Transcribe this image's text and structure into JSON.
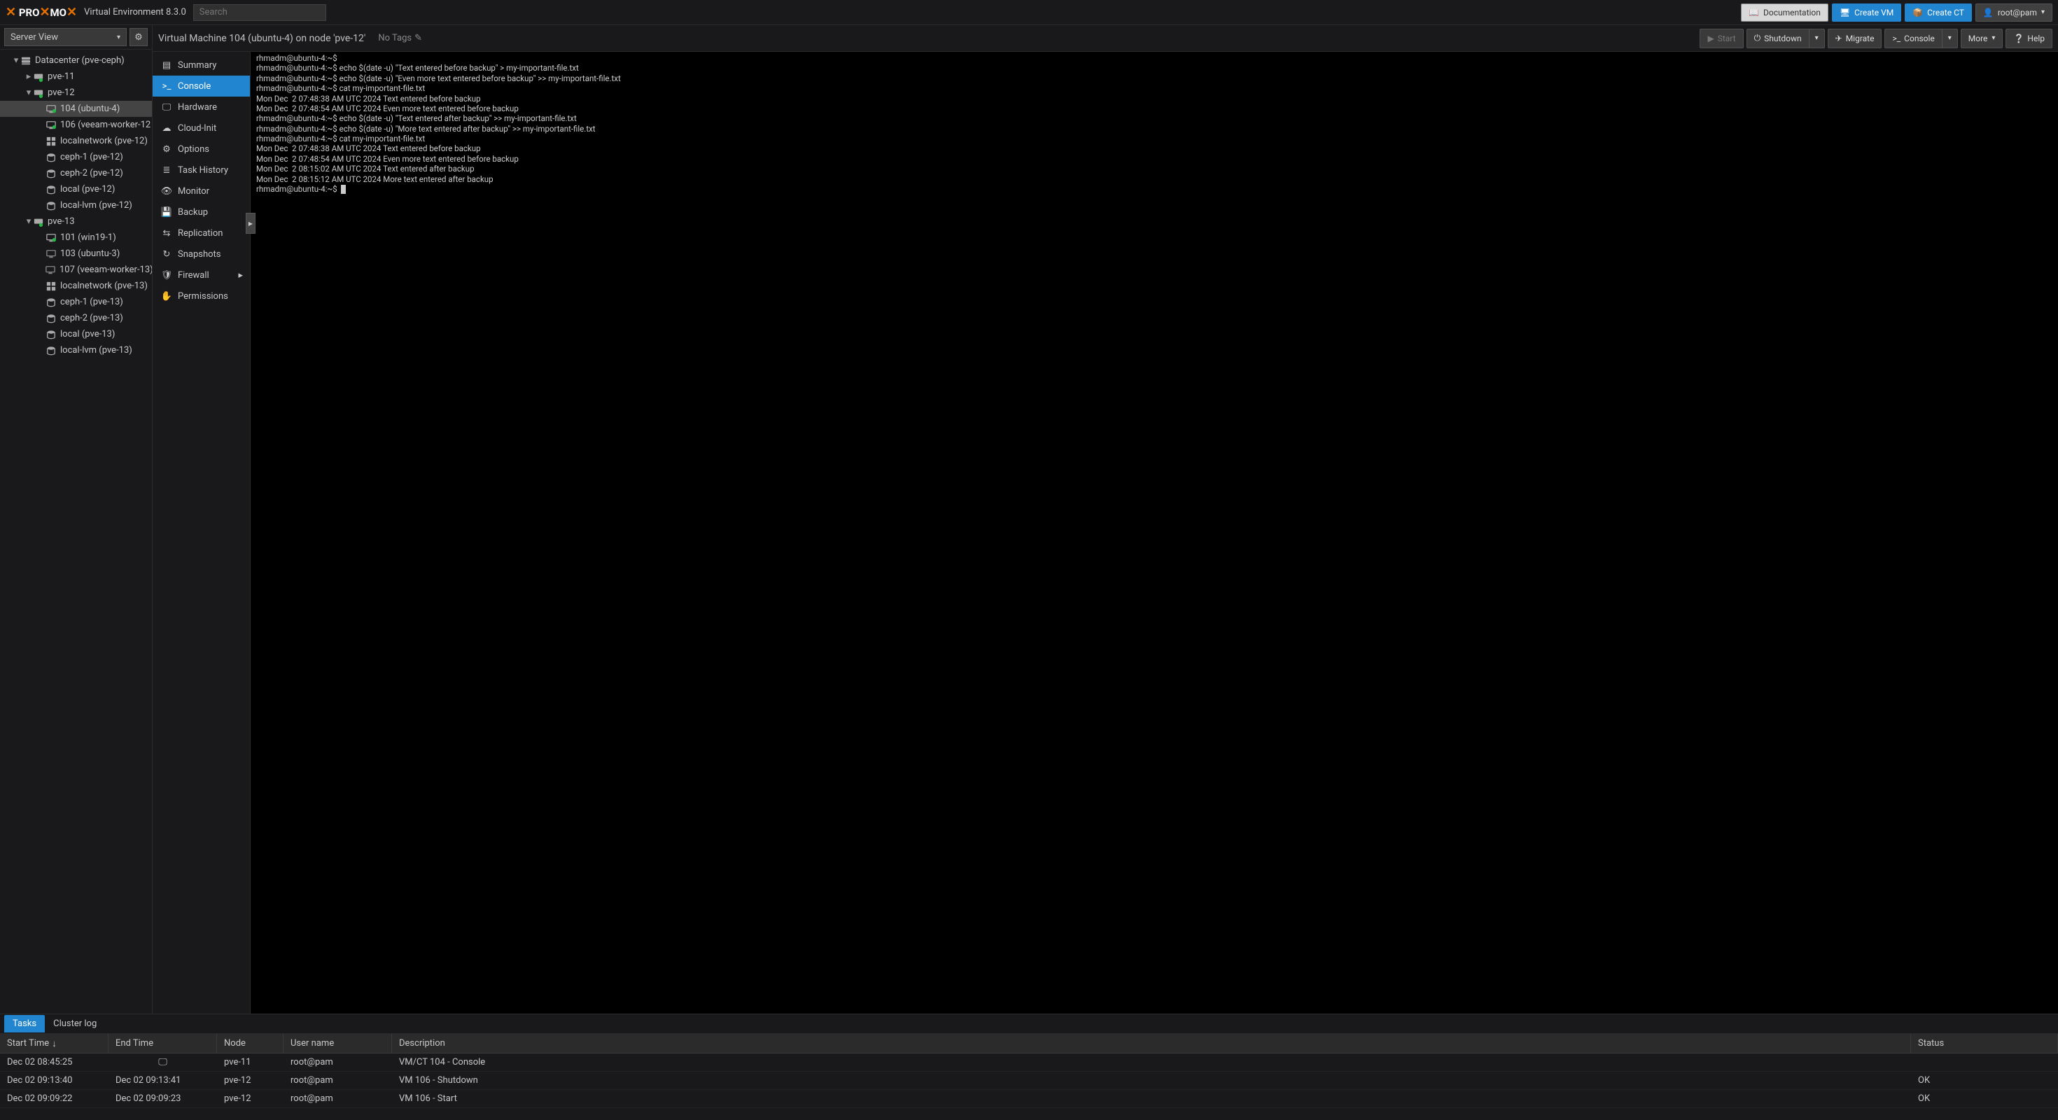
{
  "header": {
    "product": "Virtual Environment 8.3.0",
    "search_placeholder": "Search",
    "documentation": "Documentation",
    "create_vm": "Create VM",
    "create_ct": "Create CT",
    "user": "root@pam"
  },
  "view_selector": "Server View",
  "tree": [
    {
      "depth": 0,
      "caret": "▾",
      "icon": "datacenter",
      "label": "Datacenter (pve-ceph)"
    },
    {
      "depth": 1,
      "caret": "▸",
      "icon": "node",
      "label": "pve-11"
    },
    {
      "depth": 1,
      "caret": "▾",
      "icon": "node",
      "label": "pve-12"
    },
    {
      "depth": 2,
      "caret": "",
      "icon": "vm",
      "label": "104 (ubuntu-4)",
      "selected": true
    },
    {
      "depth": 2,
      "caret": "",
      "icon": "vm",
      "label": "106 (veeam-worker-12"
    },
    {
      "depth": 2,
      "caret": "",
      "icon": "net",
      "label": "localnetwork (pve-12)"
    },
    {
      "depth": 2,
      "caret": "",
      "icon": "storage",
      "label": "ceph-1 (pve-12)"
    },
    {
      "depth": 2,
      "caret": "",
      "icon": "storage",
      "label": "ceph-2 (pve-12)"
    },
    {
      "depth": 2,
      "caret": "",
      "icon": "storage",
      "label": "local (pve-12)"
    },
    {
      "depth": 2,
      "caret": "",
      "icon": "storage",
      "label": "local-lvm (pve-12)"
    },
    {
      "depth": 1,
      "caret": "▾",
      "icon": "node",
      "label": "pve-13"
    },
    {
      "depth": 2,
      "caret": "",
      "icon": "vm",
      "label": "101 (win19-1)"
    },
    {
      "depth": 2,
      "caret": "",
      "icon": "vm-off",
      "label": "103 (ubuntu-3)"
    },
    {
      "depth": 2,
      "caret": "",
      "icon": "vm-off",
      "label": "107 (veeam-worker-13)"
    },
    {
      "depth": 2,
      "caret": "",
      "icon": "net",
      "label": "localnetwork (pve-13)"
    },
    {
      "depth": 2,
      "caret": "",
      "icon": "storage",
      "label": "ceph-1 (pve-13)"
    },
    {
      "depth": 2,
      "caret": "",
      "icon": "storage",
      "label": "ceph-2 (pve-13)"
    },
    {
      "depth": 2,
      "caret": "",
      "icon": "storage",
      "label": "local (pve-13)"
    },
    {
      "depth": 2,
      "caret": "",
      "icon": "storage",
      "label": "local-lvm (pve-13)"
    }
  ],
  "content_title": "Virtual Machine 104 (ubuntu-4) on node 'pve-12'",
  "no_tags": "No Tags",
  "actions": {
    "start": "Start",
    "shutdown": "Shutdown",
    "migrate": "Migrate",
    "console": "Console",
    "more": "More",
    "help": "Help"
  },
  "menu": [
    {
      "icon": "chart",
      "label": "Summary"
    },
    {
      "icon": "term",
      "label": "Console",
      "active": true
    },
    {
      "icon": "monitor",
      "label": "Hardware"
    },
    {
      "icon": "cloud",
      "label": "Cloud-Init"
    },
    {
      "icon": "gear",
      "label": "Options"
    },
    {
      "icon": "list",
      "label": "Task History"
    },
    {
      "icon": "eye",
      "label": "Monitor"
    },
    {
      "icon": "save",
      "label": "Backup"
    },
    {
      "icon": "retweet",
      "label": "Replication"
    },
    {
      "icon": "history",
      "label": "Snapshots"
    },
    {
      "icon": "shield",
      "label": "Firewall",
      "arrow": true
    },
    {
      "icon": "hand",
      "label": "Permissions"
    }
  ],
  "console_lines": [
    "rhmadm@ubuntu-4:~$",
    "rhmadm@ubuntu-4:~$ echo $(date -u) \"Text entered before backup\" > my-important-file.txt",
    "rhmadm@ubuntu-4:~$ echo $(date -u) \"Even more text entered before backup\" >> my-important-file.txt",
    "rhmadm@ubuntu-4:~$ cat my-important-file.txt",
    "Mon Dec  2 07:48:38 AM UTC 2024 Text entered before backup",
    "Mon Dec  2 07:48:54 AM UTC 2024 Even more text entered before backup",
    "rhmadm@ubuntu-4:~$ echo $(date -u) \"Text entered after backup\" >> my-important-file.txt",
    "rhmadm@ubuntu-4:~$ echo $(date -u) \"More text entered after backup\" >> my-important-file.txt",
    "rhmadm@ubuntu-4:~$ cat my-important-file.txt",
    "Mon Dec  2 07:48:38 AM UTC 2024 Text entered before backup",
    "Mon Dec  2 07:48:54 AM UTC 2024 Even more text entered before backup",
    "Mon Dec  2 08:15:02 AM UTC 2024 Text entered after backup",
    "Mon Dec  2 08:15:12 AM UTC 2024 More text entered after backup",
    "rhmadm@ubuntu-4:~$ "
  ],
  "bottom": {
    "tabs": {
      "tasks": "Tasks",
      "cluster_log": "Cluster log"
    },
    "columns": {
      "start": "Start Time",
      "end": "End Time",
      "node": "Node",
      "user": "User name",
      "desc": "Description",
      "status": "Status"
    },
    "rows": [
      {
        "start": "Dec 02 08:45:25",
        "end_icon": true,
        "end": "",
        "node": "pve-11",
        "user": "root@pam",
        "desc": "VM/CT 104 - Console",
        "status": ""
      },
      {
        "start": "Dec 02 09:13:40",
        "end": "Dec 02 09:13:41",
        "node": "pve-12",
        "user": "root@pam",
        "desc": "VM 106 - Shutdown",
        "status": "OK"
      },
      {
        "start": "Dec 02 09:09:22",
        "end": "Dec 02 09:09:23",
        "node": "pve-12",
        "user": "root@pam",
        "desc": "VM 106 - Start",
        "status": "OK"
      }
    ]
  },
  "icons": {
    "datacenter": "▤",
    "node": "🖥",
    "vm": "🖵",
    "vm-off": "🖵",
    "net": "⊞",
    "storage": "⛁",
    "chart": "☰",
    "term": ">_",
    "monitor": "🖵",
    "cloud": "☁",
    "gear": "⚙",
    "list": "≣",
    "eye": "👁",
    "save": "💾",
    "retweet": "⇄",
    "history": "↻",
    "shield": "🛡",
    "hand": "✋",
    "book": "📖",
    "desktop": "🖥",
    "cube": "📦",
    "power": "⏻",
    "plane": "✈",
    "caret": "▾",
    "help": "?",
    "play": "▶",
    "pencil": "✎"
  }
}
